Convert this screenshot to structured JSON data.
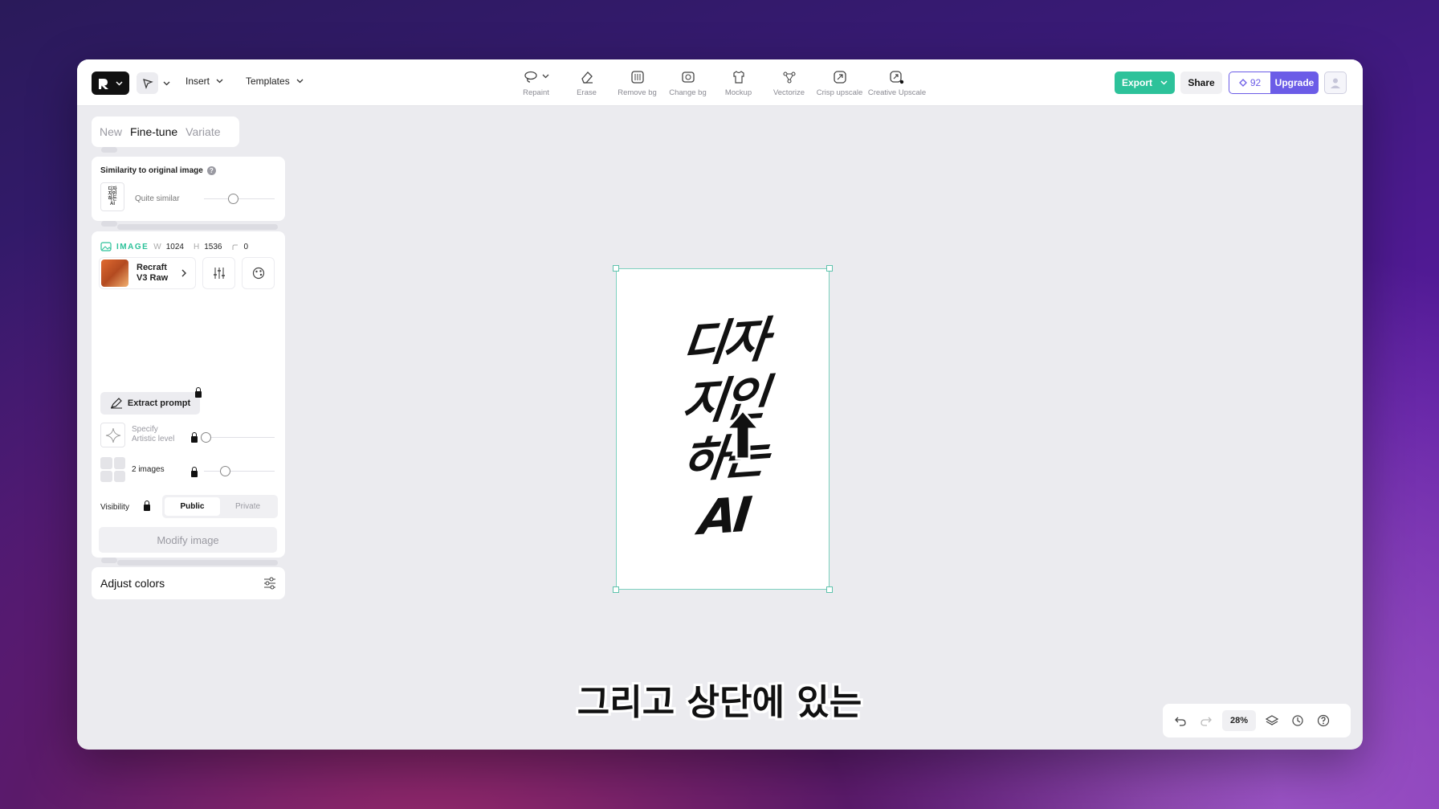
{
  "header": {
    "menus": [
      {
        "label": "Insert"
      },
      {
        "label": "Templates"
      }
    ],
    "tools": [
      {
        "label": "Repaint",
        "icon": "lasso-icon"
      },
      {
        "label": "Erase",
        "icon": "eraser-icon"
      },
      {
        "label": "Remove bg",
        "icon": "remove-bg-icon"
      },
      {
        "label": "Change bg",
        "icon": "change-bg-icon"
      },
      {
        "label": "Mockup",
        "icon": "tshirt-icon"
      },
      {
        "label": "Vectorize",
        "icon": "vector-icon"
      },
      {
        "label": "Crisp upscale",
        "icon": "upscale-icon"
      },
      {
        "label": "Creative Upscale",
        "icon": "creative-upscale-icon"
      }
    ],
    "export_label": "Export",
    "share_label": "Share",
    "credits": "92",
    "upgrade_label": "Upgrade"
  },
  "modes": {
    "tabs": [
      "New",
      "Fine-tune",
      "Variate"
    ],
    "active": "Fine-tune"
  },
  "similarity": {
    "title": "Similarity to original image",
    "value_label": "Quite similar",
    "thumb_text": "디자\n지인\n하는\nAI"
  },
  "image_settings": {
    "tag": "IMAGE",
    "w_key": "W",
    "w": "1024",
    "h_key": "H",
    "h": "1536",
    "rotation": "0",
    "model_line1": "Recraft",
    "model_line2": "V3 Raw"
  },
  "extract_label": "Extract prompt",
  "artistic": {
    "line1": "Specify",
    "line2": "Artistic level"
  },
  "images_count_label": "2 images",
  "visibility": {
    "label": "Visibility",
    "options": [
      "Public",
      "Private"
    ],
    "selected": "Public"
  },
  "modify_label": "Modify image",
  "adjust_label": "Adjust colors",
  "canvas": {
    "lines": [
      "디자",
      "지인",
      "하는",
      "AI"
    ]
  },
  "subtitle": "그리고 상단에 있는",
  "zoom": "28%",
  "colors": {
    "accent": "#2dc29a",
    "brand": "#6b5ce7"
  }
}
